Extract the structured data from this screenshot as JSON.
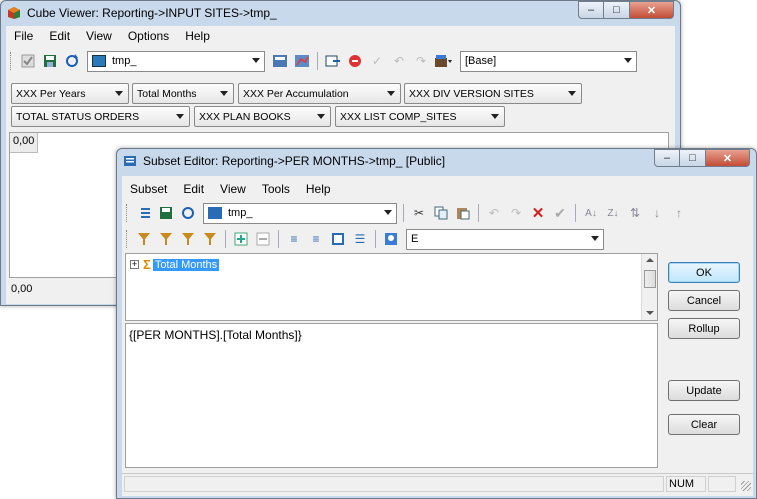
{
  "cube_viewer": {
    "title": "Cube Viewer: Reporting->INPUT SITES->tmp_",
    "menu": [
      "File",
      "Edit",
      "View",
      "Options",
      "Help"
    ],
    "view_combo": "tmp_",
    "base_combo": "[Base]",
    "dims_row1": [
      "XXX Per Years",
      "Total Months",
      "XXX Per Accumulation",
      "XXX DIV VERSION SITES"
    ],
    "dims_row2": [
      "TOTAL STATUS ORDERS",
      "XXX PLAN BOOKS",
      "XXX LIST COMP_SITES"
    ],
    "cell_top": "0,00",
    "cell_bottom": "0,00"
  },
  "subset_editor": {
    "title": "Subset Editor:  Reporting->PER MONTHS->tmp_  [Public]",
    "menu": [
      "Subset",
      "Edit",
      "View",
      "Tools",
      "Help"
    ],
    "subset_combo": "tmp_",
    "alias_combo": "E",
    "tree_item": "Total Months",
    "expression": "{[PER MONTHS].[Total Months]}",
    "buttons": {
      "ok": "OK",
      "cancel": "Cancel",
      "rollup": "Rollup",
      "update": "Update",
      "clear": "Clear"
    },
    "status_num": "NUM"
  },
  "colors": {
    "accent_select": "#3399ff",
    "titlebar": "#c9d9ec"
  }
}
